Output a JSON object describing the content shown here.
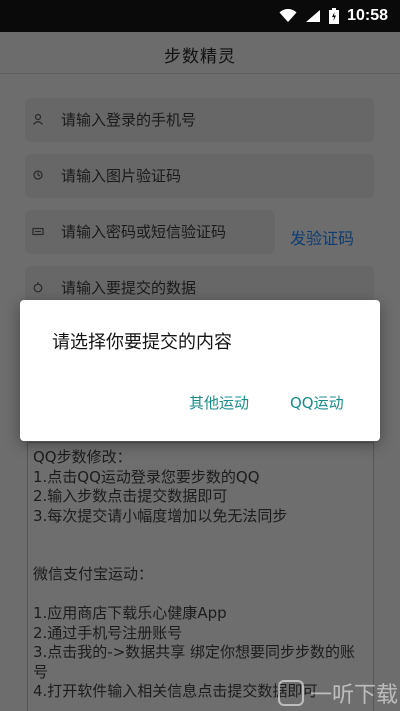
{
  "status_bar": {
    "time": "10:58",
    "icons": [
      "wifi-icon",
      "signal-icon",
      "battery-icon"
    ]
  },
  "app_bar": {
    "title": "步数精灵"
  },
  "form": {
    "phone_placeholder": "请输入登录的手机号",
    "captcha_placeholder": "请输入图片验证码",
    "password_placeholder": "请输入密码或短信验证码",
    "send_code_label": "发验证码",
    "data_placeholder": "请输入要提交的数据"
  },
  "instructions": {
    "text": "QQ步数修改：\n1.点击QQ运动登录您要步数的QQ\n2.输入步数点击提交数据即可\n3.每次提交请小幅度增加以免无法同步\n\n\n微信支付宝运动：\n\n1.应用商店下载乐心健康App\n2.通过手机号注册账号\n3.点击我的->数据共享 绑定你想要同步步数的账号\n4.打开软件输入相关信息点击提交数据即可"
  },
  "dialog": {
    "title": "请选择你要提交的内容",
    "option_other": "其他运动",
    "option_qq": "QQ运动"
  },
  "watermark": {
    "text": "一听下载"
  },
  "colors": {
    "accent": "#1a8b8b",
    "send_code": "#0d3d72",
    "dim_background": "#6d6d6d",
    "dialog_bg": "#ffffff"
  }
}
